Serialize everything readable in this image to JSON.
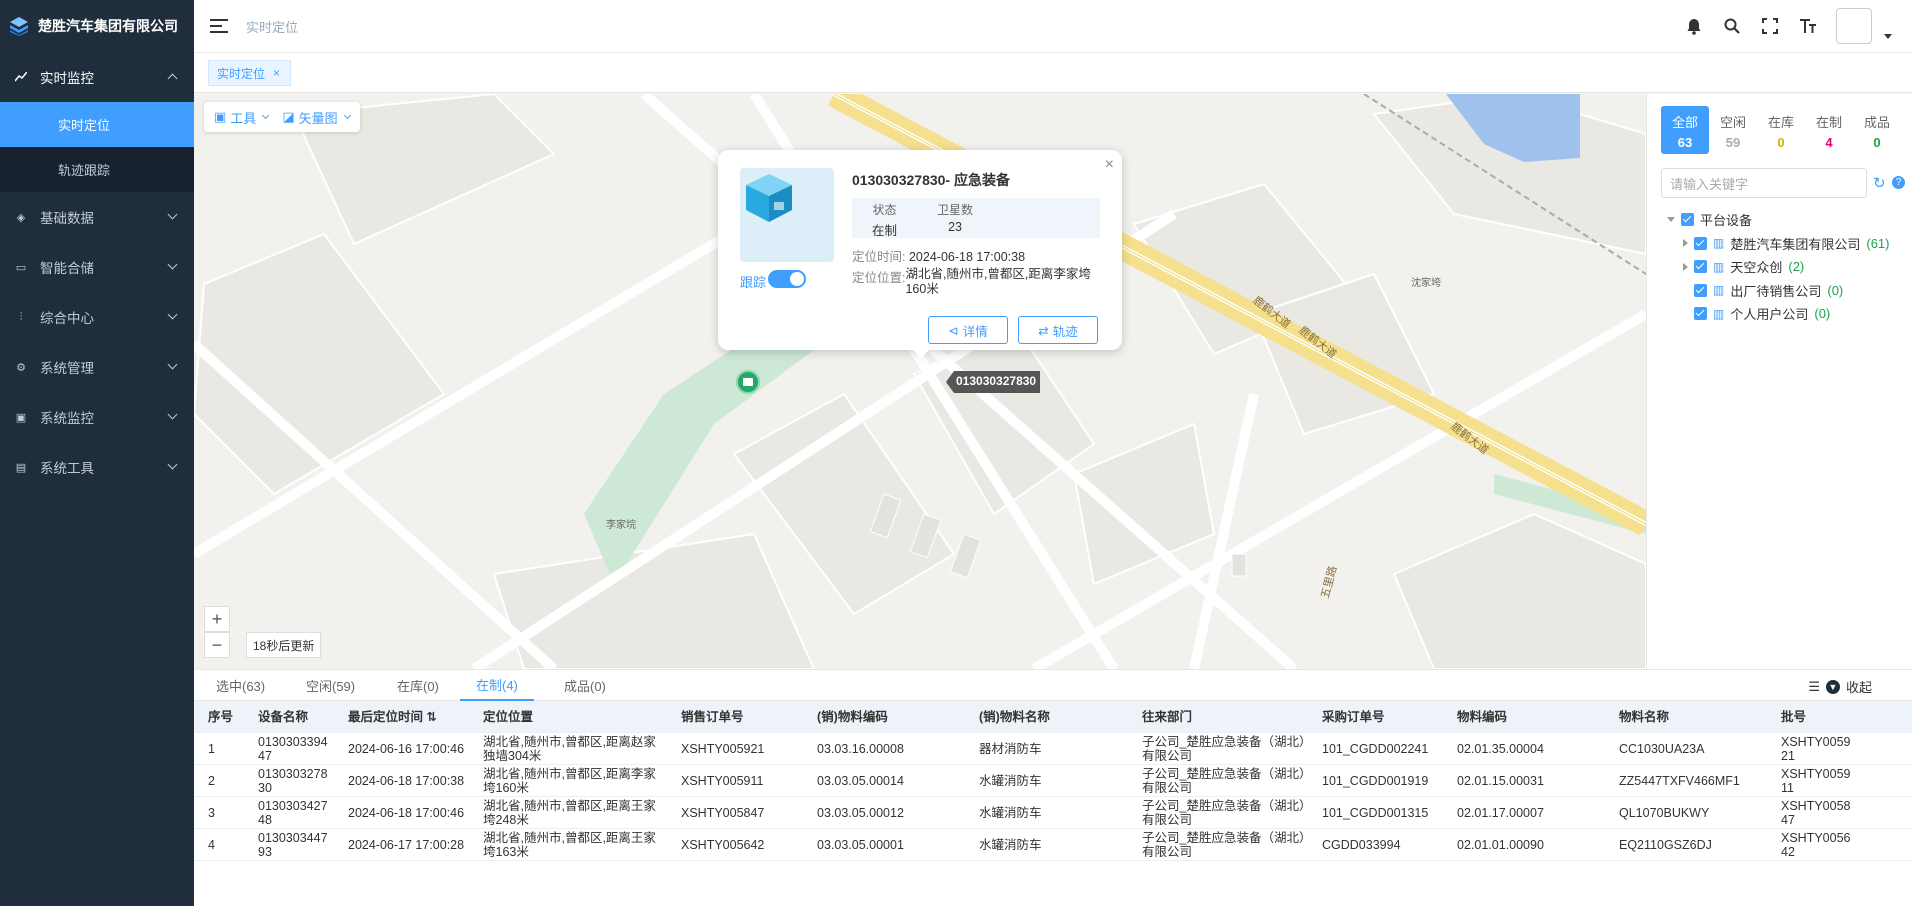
{
  "brand": {
    "name": "楚胜汽车集团有限公司"
  },
  "sidebar": {
    "items": [
      {
        "label": "实时监控",
        "icon": "chart-line-icon"
      },
      {
        "label": "基础数据",
        "icon": "layers-icon"
      },
      {
        "label": "智能合储",
        "icon": "monitor-icon"
      },
      {
        "label": "综合中心",
        "icon": "sliders-icon"
      },
      {
        "label": "系统管理",
        "icon": "gear-icon"
      },
      {
        "label": "系统监控",
        "icon": "screen-icon"
      },
      {
        "label": "系统工具",
        "icon": "toolbox-icon"
      }
    ],
    "sub_items": [
      {
        "label": "实时定位"
      },
      {
        "label": "轨迹跟踪"
      }
    ]
  },
  "header": {
    "breadcrumb": "实时定位"
  },
  "tags": {
    "current": "实时定位",
    "close": "×"
  },
  "map": {
    "toolbar": {
      "tools": "工具",
      "layer": "矢量图"
    },
    "zoom_in": "+",
    "zoom_out": "−",
    "refresh_text": "18秒后更新",
    "labels": {
      "place1": "沈家垮",
      "place2": "李家垸",
      "road1": "鹿鹤大道",
      "road2": "鹿鹤大道",
      "road3": "鹿鹤大道",
      "road4": "五里路"
    },
    "marker_label": "013030327830"
  },
  "popup": {
    "title": "013030327830- 应急装备",
    "status_key": "状态",
    "status_val": "在制",
    "sat_key": "卫星数",
    "sat_val": "23",
    "time_key": "定位时间:",
    "time_val": "2024-06-18 17:00:38",
    "loc_key": "定位位置:",
    "loc_val": "湖北省,随州市,曾都区,距离李家垮160米",
    "track_label": "跟踪",
    "detail_btn": "详情",
    "track_btn": "轨迹",
    "close": "×"
  },
  "right_panel": {
    "status_tabs": [
      {
        "label": "全部",
        "count": "63"
      },
      {
        "label": "空闲",
        "count": "59"
      },
      {
        "label": "在库",
        "count": "0"
      },
      {
        "label": "在制",
        "count": "4"
      },
      {
        "label": "成品",
        "count": "0"
      }
    ],
    "search_placeholder": "请输入关键字",
    "tree": {
      "root": "平台设备",
      "children": [
        {
          "label": "楚胜汽车集团有限公司",
          "count": "(61)"
        },
        {
          "label": "天空众创",
          "count": "(2)"
        },
        {
          "label": "出厂待销售公司",
          "count": "(0)"
        },
        {
          "label": "个人用户公司",
          "count": "(0)"
        }
      ]
    }
  },
  "bottom_tabs": [
    "选中(63)",
    "空闲(59)",
    "在库(0)",
    "在制(4)",
    "成品(0)"
  ],
  "collapse_label": "收起",
  "table": {
    "headers": [
      "序号",
      "设备名称",
      "最后定位时间",
      "定位位置",
      "销售订单号",
      "(销)物料编码",
      "(销)物料名称",
      "往来部门",
      "采购订单号",
      "物料编码",
      "物料名称",
      "批号"
    ],
    "rows": [
      [
        "1",
        "013030339447",
        "2024-06-16 17:00:46",
        "湖北省,随州市,曾都区,距离赵家独墙304米",
        "XSHTY005921",
        "03.03.16.00008",
        "器材消防车",
        "子公司_楚胜应急装备（湖北）有限公司",
        "101_CGDD002241",
        "02.01.35.00004",
        "CC1030UA23A",
        "XSHTY005921"
      ],
      [
        "2",
        "013030327830",
        "2024-06-18 17:00:38",
        "湖北省,随州市,曾都区,距离李家垮160米",
        "XSHTY005911",
        "03.03.05.00014",
        "水罐消防车",
        "子公司_楚胜应急装备（湖北）有限公司",
        "101_CGDD001919",
        "02.01.15.00031",
        "ZZ5447TXFV466MF1",
        "XSHTY005911"
      ],
      [
        "3",
        "013030342748",
        "2024-06-18 17:00:46",
        "湖北省,随州市,曾都区,距离王家垮248米",
        "XSHTY005847",
        "03.03.05.00012",
        "水罐消防车",
        "子公司_楚胜应急装备（湖北）有限公司",
        "101_CGDD001315",
        "02.01.17.00007",
        "QL1070BUKWY",
        "XSHTY005847"
      ],
      [
        "4",
        "013030344793",
        "2024-06-17 17:00:28",
        "湖北省,随州市,曾都区,距离王家垮163米",
        "XSHTY005642",
        "03.03.05.00001",
        "水罐消防车",
        "子公司_楚胜应急装备（湖北）有限公司",
        "CGDD033994",
        "02.01.01.00090",
        "EQ2110GSZ6DJ",
        "XSHTY005642"
      ]
    ]
  },
  "colors": {
    "accent": "#409eff",
    "sidebar_bg": "#1f2d3d",
    "status_wip": "#e6007a",
    "status_ok": "#1aa34a"
  }
}
